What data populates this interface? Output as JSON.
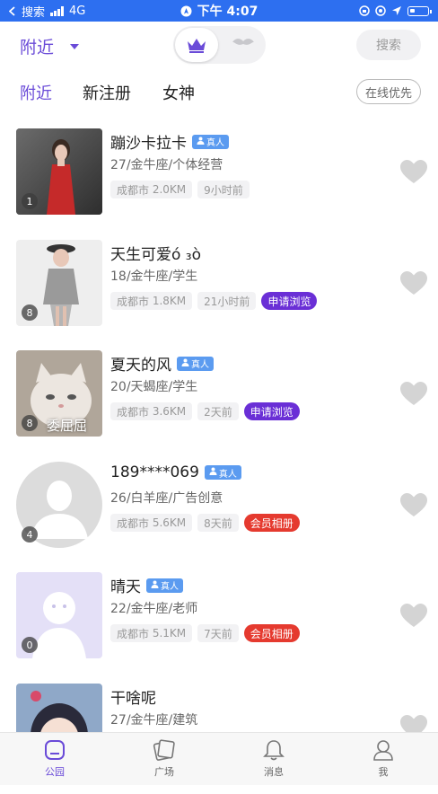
{
  "status": {
    "carrier": "搜索",
    "network": "4G",
    "time": "下午 4:07"
  },
  "header": {
    "city": "附近",
    "search_label": "搜索"
  },
  "tabs": {
    "nearby": "附近",
    "new": "新注册",
    "goddess": "女神",
    "online_first": "在线优先"
  },
  "users": [
    {
      "name": "蹦沙卡拉卡",
      "real": true,
      "real_label": "真人",
      "info": "27/金牛座/个体经营",
      "city": "成都市",
      "distance": "2.0KM",
      "time": "9小时前",
      "tag": "",
      "photos": "1",
      "avatar": "red-dress"
    },
    {
      "name": "天生可爱ó ₃ò",
      "real": false,
      "real_label": "",
      "info": "18/金牛座/学生",
      "city": "成都市",
      "distance": "1.8KM",
      "time": "21小时前",
      "tag": "申请浏览",
      "tag_color": "purple",
      "photos": "8",
      "avatar": "grey-coat"
    },
    {
      "name": "夏天的风",
      "real": true,
      "real_label": "真人",
      "info": "20/天蝎座/学生",
      "city": "成都市",
      "distance": "3.6KM",
      "time": "2天前",
      "tag": "申请浏览",
      "tag_color": "purple",
      "photos": "8",
      "avatar": "cat",
      "avatar_text": "委屈屈"
    },
    {
      "name": "189****069",
      "real": true,
      "real_label": "真人",
      "info": "26/白羊座/广告创意",
      "city": "成都市",
      "distance": "5.6KM",
      "time": "8天前",
      "tag": "会员相册",
      "tag_color": "red",
      "photos": "4",
      "avatar": "default"
    },
    {
      "name": "晴天",
      "real": true,
      "real_label": "真人",
      "info": "22/金牛座/老师",
      "city": "成都市",
      "distance": "5.1KM",
      "time": "7天前",
      "tag": "会员相册",
      "tag_color": "red",
      "photos": "0",
      "avatar": "default-lavender"
    },
    {
      "name": "干啥呢",
      "real": false,
      "real_label": "",
      "info": "27/金牛座/建筑",
      "city": "",
      "distance": "",
      "time": "",
      "tag": "",
      "photos": "",
      "avatar": "anime"
    }
  ],
  "bottom_nav": [
    {
      "label": "公园",
      "icon": "park-icon",
      "active": true
    },
    {
      "label": "广场",
      "icon": "square-icon",
      "active": false
    },
    {
      "label": "消息",
      "icon": "bell-icon",
      "active": false
    },
    {
      "label": "我",
      "icon": "person-icon",
      "active": false
    }
  ],
  "colors": {
    "accent": "#6a4bd8",
    "status_bar": "#2d6ff0",
    "tag_purple": "#6a2fd6",
    "tag_red": "#e53a2f",
    "real_badge": "#5b9bf0"
  }
}
